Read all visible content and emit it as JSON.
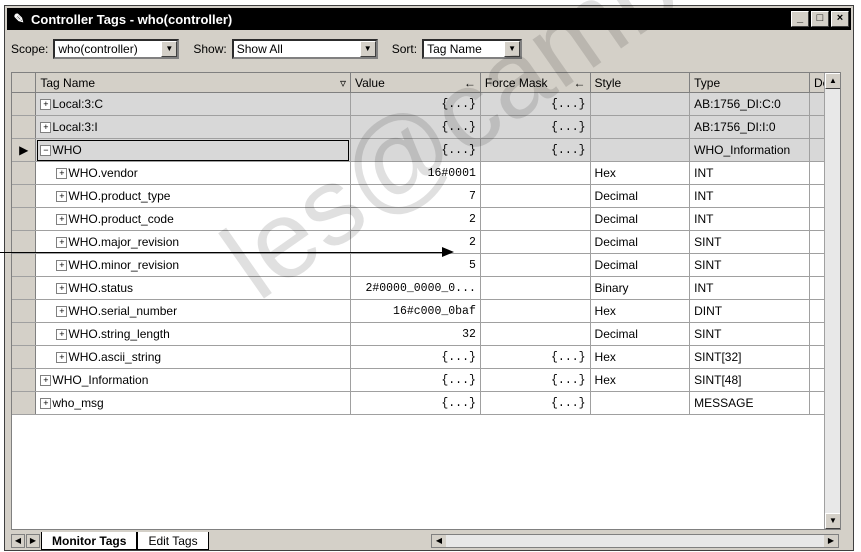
{
  "window": {
    "title": "Controller Tags - who(controller)",
    "buttons": [
      "_",
      "□",
      "×"
    ]
  },
  "filters": {
    "scope_label": "Scope:",
    "scope_value": "who(controller)",
    "show_label": "Show:",
    "show_value": "Show All",
    "sort_label": "Sort:",
    "sort_value": "Tag Name"
  },
  "grid": {
    "columns": [
      "Tag Name",
      "Value",
      "Force Mask",
      "Style",
      "Type",
      "De"
    ],
    "rows": [
      {
        "exp": "+",
        "name": "Local:3:C",
        "value": "{...}",
        "force": "{...}",
        "style": "",
        "type": "AB:1756_DI:C:0",
        "indent": 0,
        "gray": true
      },
      {
        "exp": "+",
        "name": "Local:3:I",
        "value": "{...}",
        "force": "{...}",
        "style": "",
        "type": "AB:1756_DI:I:0",
        "indent": 0,
        "gray": true
      },
      {
        "exp": "−",
        "name": "WHO",
        "value": "{...}",
        "force": "{...}",
        "style": "",
        "type": "WHO_Information",
        "indent": 0,
        "gray": true,
        "current": true
      },
      {
        "exp": "+",
        "name": "WHO.vendor",
        "value": "16#0001",
        "force": "",
        "style": "Hex",
        "type": "INT",
        "indent": 1,
        "gray": false
      },
      {
        "exp": "+",
        "name": "WHO.product_type",
        "value": "7",
        "force": "",
        "style": "Decimal",
        "type": "INT",
        "indent": 1,
        "gray": false
      },
      {
        "exp": "+",
        "name": "WHO.product_code",
        "value": "2",
        "force": "",
        "style": "Decimal",
        "type": "INT",
        "indent": 1,
        "gray": false
      },
      {
        "exp": "+",
        "name": "WHO.major_revision",
        "value": "2",
        "force": "",
        "style": "Decimal",
        "type": "SINT",
        "indent": 1,
        "gray": false
      },
      {
        "exp": "+",
        "name": "WHO.minor_revision",
        "value": "5",
        "force": "",
        "style": "Decimal",
        "type": "SINT",
        "indent": 1,
        "gray": false
      },
      {
        "exp": "+",
        "name": "WHO.status",
        "value": "2#0000_0000_0...",
        "force": "",
        "style": "Binary",
        "type": "INT",
        "indent": 1,
        "gray": false
      },
      {
        "exp": "+",
        "name": "WHO.serial_number",
        "value": "16#c000_0baf",
        "force": "",
        "style": "Hex",
        "type": "DINT",
        "indent": 1,
        "gray": false
      },
      {
        "exp": "+",
        "name": "WHO.string_length",
        "value": "32",
        "force": "",
        "style": "Decimal",
        "type": "SINT",
        "indent": 1,
        "gray": false
      },
      {
        "exp": "+",
        "name": "WHO.ascii_string",
        "value": "{...}",
        "force": "{...}",
        "style": "Hex",
        "type": "SINT[32]",
        "indent": 1,
        "gray": false
      },
      {
        "exp": "+",
        "name": "WHO_Information",
        "value": "{...}",
        "force": "{...}",
        "style": "Hex",
        "type": "SINT[48]",
        "indent": 0,
        "gray": false
      },
      {
        "exp": "+",
        "name": "who_msg",
        "value": "{...}",
        "force": "{...}",
        "style": "",
        "type": "MESSAGE",
        "indent": 0,
        "gray": false
      }
    ]
  },
  "tabs": [
    "Monitor Tags",
    "Edit Tags"
  ],
  "watermark": "les@cambia.c"
}
